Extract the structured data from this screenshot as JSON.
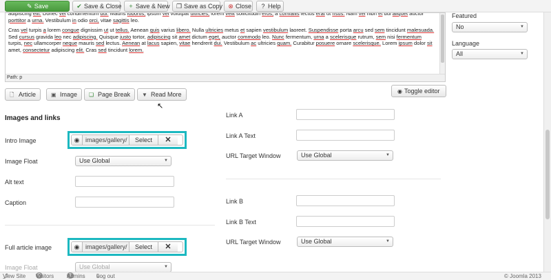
{
  "toolbar": {
    "save": "Save",
    "save_close": "Save & Close",
    "save_new": "Save & New",
    "save_copy": "Save as Copy",
    "close": "Close",
    "help": "Help"
  },
  "editor": {
    "paragraph1": "adipiscing elit. Donec vel condimentum dui. Mauris lobortis, ipsum vel volutpat ultricies, lorem velit sollicitudin eros, a convallis lectus erat ut risus. Nam vel nibh et dui aliquet auctor porttitor a urna. Vestibulum in odio orci, vitae sagittis leo.",
    "paragraph2": "Cras vel turpis a lorem congue dignissim ut ut tellus. Aenean quis varius libero. Nulla ultricies metus et sapien vestibulum laoreet. Suspendisse porta arcu sed sem tincidunt malesuada. Sed cursus gravida leo nec adipiscing. Quisque justo tortor, adipiscing sit amet dictum eget, auctor commodo leo. Nunc fermentum, urna a scelerisque rutrum, sem nisi fermentum turpis, nec ullamcorper neque mauris sed lectus. Aenean at lacus sapien, vitae hendrerit dui. Vestibulum ac ultricies quam. Curabitur posuere ornare scelerisque. Lorem ipsum dolor sit amet, consectetur adipiscing elit. Cras sed tincidunt lorem.",
    "path": "Path: p"
  },
  "editor_buttons": {
    "article": "Article",
    "image": "Image",
    "page_break": "Page Break",
    "read_more": "Read More",
    "toggle_editor": "Toggle editor"
  },
  "images": {
    "heading": "Images and links",
    "intro_image_label": "Intro Image",
    "intro_image_path": "images/gallery/",
    "select": "Select",
    "image_float_label": "Image Float",
    "image_float_value": "Use Global",
    "alt_text_label": "Alt text",
    "caption_label": "Caption",
    "full_image_label": "Full article image",
    "full_image_path": "images/gallery/",
    "full_image_float_label": "Image Float",
    "full_image_float_value": "Use Global"
  },
  "links": {
    "link_a": "Link A",
    "link_a_text": "Link A Text",
    "url_target_a": "URL Target Window",
    "url_target_a_value": "Use Global",
    "link_b": "Link B",
    "link_b_text": "Link B Text",
    "url_target_b": "URL Target Window",
    "url_target_b_value": "Use Global"
  },
  "sidebar": {
    "featured_label": "Featured",
    "featured_value": "No",
    "language_label": "Language",
    "language_value": "All"
  },
  "statusbar": {
    "view_site": "View Site",
    "visitors_count": "0",
    "visitors": "Visitors",
    "admins_count": "1",
    "admins": "Admins",
    "logout_count": "0",
    "logout": "Log out",
    "copyright": "© Joomla 2013"
  },
  "colors": {
    "save_green": "#4a9a3e",
    "highlight_cyan": "#1cb8c0"
  }
}
